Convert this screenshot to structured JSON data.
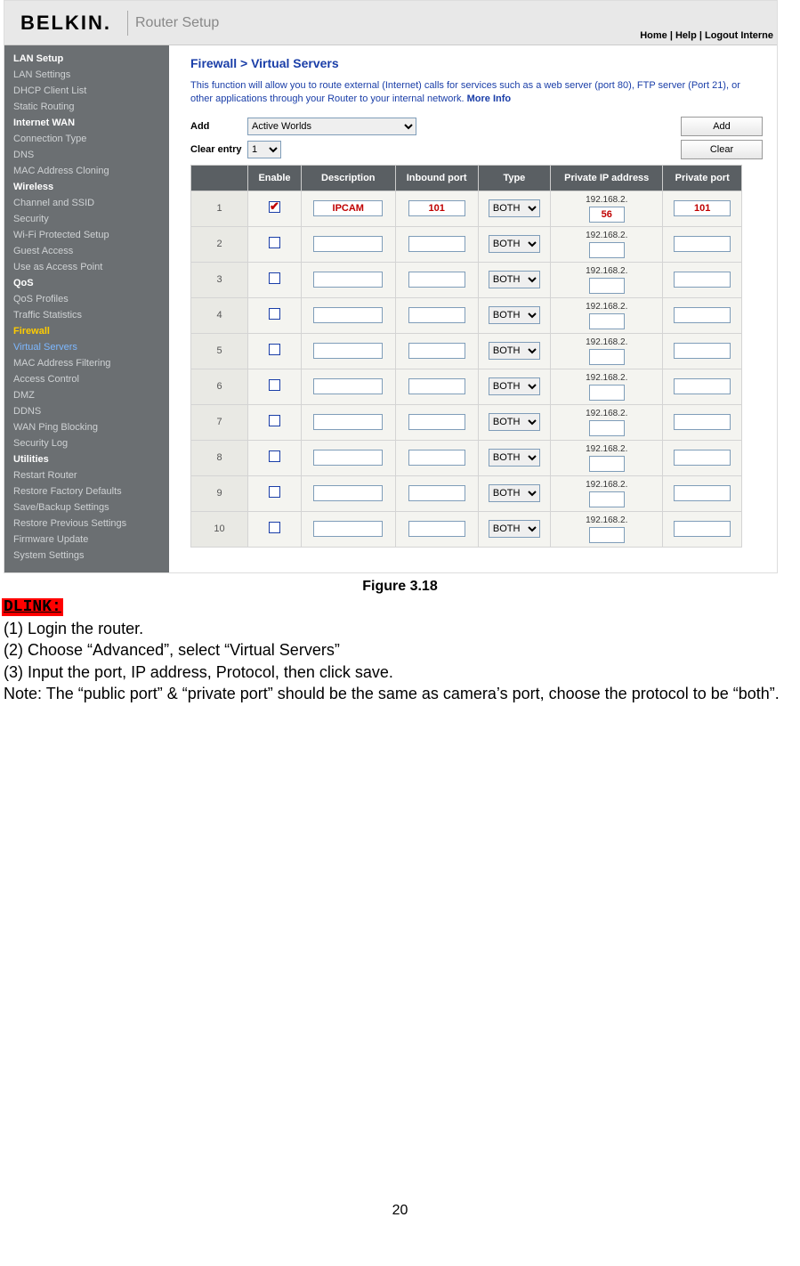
{
  "header": {
    "brand": "BELKIN.",
    "title": "Router Setup",
    "links": "Home | Help | Logout   Interne"
  },
  "sidebar": [
    {
      "type": "cat",
      "label": "LAN Setup"
    },
    {
      "type": "item",
      "label": "LAN Settings"
    },
    {
      "type": "item",
      "label": "DHCP Client List"
    },
    {
      "type": "item",
      "label": "Static Routing"
    },
    {
      "type": "cat",
      "label": "Internet WAN"
    },
    {
      "type": "item",
      "label": "Connection Type"
    },
    {
      "type": "item",
      "label": "DNS"
    },
    {
      "type": "item",
      "label": "MAC Address Cloning"
    },
    {
      "type": "cat",
      "label": "Wireless"
    },
    {
      "type": "item",
      "label": "Channel and SSID"
    },
    {
      "type": "item",
      "label": "Security"
    },
    {
      "type": "item",
      "label": "Wi-Fi Protected Setup"
    },
    {
      "type": "item",
      "label": "Guest Access"
    },
    {
      "type": "item",
      "label": "Use as Access Point"
    },
    {
      "type": "cat",
      "label": "QoS"
    },
    {
      "type": "item",
      "label": "QoS Profiles"
    },
    {
      "type": "item",
      "label": "Traffic Statistics"
    },
    {
      "type": "item",
      "label": "Firewall",
      "cls": "firewall"
    },
    {
      "type": "item",
      "label": "Virtual Servers",
      "cls": "vserv"
    },
    {
      "type": "item",
      "label": "MAC Address Filtering"
    },
    {
      "type": "item",
      "label": "Access Control"
    },
    {
      "type": "item",
      "label": "DMZ"
    },
    {
      "type": "item",
      "label": "DDNS"
    },
    {
      "type": "item",
      "label": "WAN Ping Blocking"
    },
    {
      "type": "item",
      "label": "Security Log"
    },
    {
      "type": "cat",
      "label": "Utilities"
    },
    {
      "type": "item",
      "label": "Restart Router"
    },
    {
      "type": "item",
      "label": "Restore Factory Defaults"
    },
    {
      "type": "item",
      "label": "Save/Backup Settings"
    },
    {
      "type": "item",
      "label": "Restore Previous Settings"
    },
    {
      "type": "item",
      "label": "Firmware Update"
    },
    {
      "type": "item",
      "label": "System Settings"
    }
  ],
  "main": {
    "breadcrumb": "Firewall >  Virtual Servers",
    "desc": "This function will allow you to route external (Internet) calls for services such as a web server (port 80), FTP server (Port 21), or other applications through your Router to your internal network. ",
    "more": "More Info",
    "add_label": "Add",
    "add_value": "Active Worlds",
    "add_button": "Add",
    "clear_label": "Clear entry",
    "clear_value": "1",
    "clear_button": "Clear",
    "cols": [
      "",
      "Enable",
      "Description",
      "Inbound port",
      "Type",
      "Private IP address",
      "Private port"
    ],
    "ip_prefix": "192.168.2.",
    "type_option": "BOTH",
    "rows": [
      {
        "n": "1",
        "enabled": true,
        "desc": "IPCAM",
        "inport": "101",
        "ip": "56",
        "pport": "101",
        "red": true
      },
      {
        "n": "2",
        "enabled": false,
        "desc": "",
        "inport": "",
        "ip": "",
        "pport": ""
      },
      {
        "n": "3",
        "enabled": false,
        "desc": "",
        "inport": "",
        "ip": "",
        "pport": ""
      },
      {
        "n": "4",
        "enabled": false,
        "desc": "",
        "inport": "",
        "ip": "",
        "pport": ""
      },
      {
        "n": "5",
        "enabled": false,
        "desc": "",
        "inport": "",
        "ip": "",
        "pport": ""
      },
      {
        "n": "6",
        "enabled": false,
        "desc": "",
        "inport": "",
        "ip": "",
        "pport": ""
      },
      {
        "n": "7",
        "enabled": false,
        "desc": "",
        "inport": "",
        "ip": "",
        "pport": ""
      },
      {
        "n": "8",
        "enabled": false,
        "desc": "",
        "inport": "",
        "ip": "",
        "pport": ""
      },
      {
        "n": "9",
        "enabled": false,
        "desc": "",
        "inport": "",
        "ip": "",
        "pport": ""
      },
      {
        "n": "10",
        "enabled": false,
        "desc": "",
        "inport": "",
        "ip": "",
        "pport": ""
      }
    ]
  },
  "doc": {
    "figure": "Figure 3.18",
    "dlink": "DLINK:",
    "line1": "(1) Login the router.",
    "line2": "(2) Choose “Advanced”, select “Virtual Servers”",
    "line3": "(3) Input the port, IP address, Protocol, then click save.",
    "line4": "Note: The “public port” & “private port” should be the same as camera’s port, choose the protocol to be “both”.",
    "pagenum": "20"
  }
}
